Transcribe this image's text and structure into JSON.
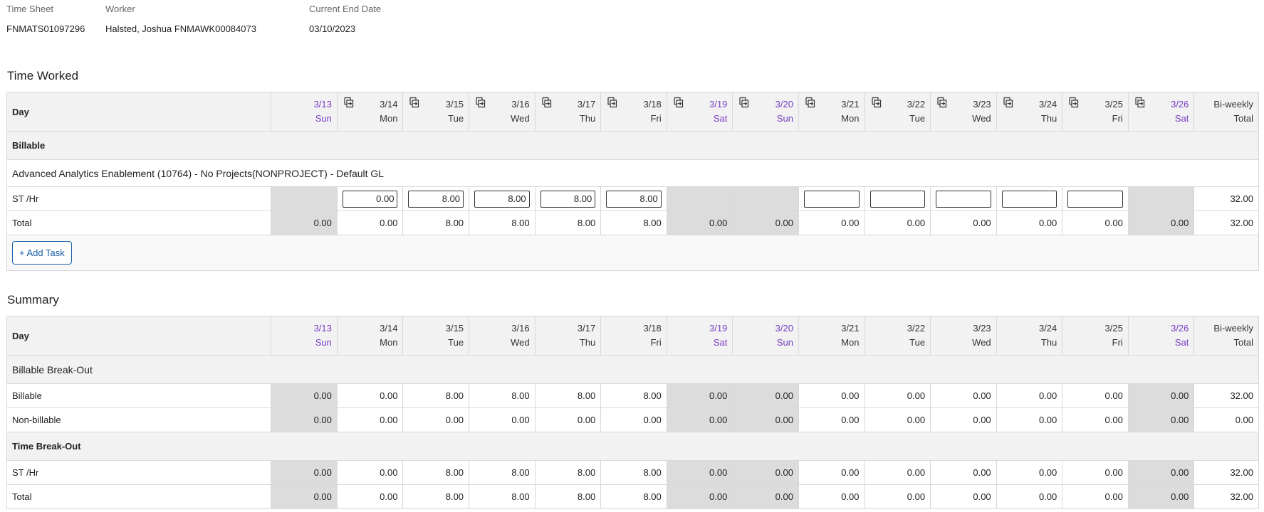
{
  "header": {
    "fields": [
      {
        "label": "Time Sheet",
        "value": "FNMATS01097296"
      },
      {
        "label": "Worker",
        "value": "Halsted, Joshua FNMAWK00084073"
      },
      {
        "label": "Current End Date",
        "value": "03/10/2023"
      }
    ]
  },
  "days": [
    {
      "date": "3/13",
      "dow": "Sun",
      "weekend": true
    },
    {
      "date": "3/14",
      "dow": "Mon",
      "weekend": false
    },
    {
      "date": "3/15",
      "dow": "Tue",
      "weekend": false
    },
    {
      "date": "3/16",
      "dow": "Wed",
      "weekend": false
    },
    {
      "date": "3/17",
      "dow": "Thu",
      "weekend": false
    },
    {
      "date": "3/18",
      "dow": "Fri",
      "weekend": false
    },
    {
      "date": "3/19",
      "dow": "Sat",
      "weekend": true
    },
    {
      "date": "3/20",
      "dow": "Sun",
      "weekend": true
    },
    {
      "date": "3/21",
      "dow": "Mon",
      "weekend": false
    },
    {
      "date": "3/22",
      "dow": "Tue",
      "weekend": false
    },
    {
      "date": "3/23",
      "dow": "Wed",
      "weekend": false
    },
    {
      "date": "3/24",
      "dow": "Thu",
      "weekend": false
    },
    {
      "date": "3/25",
      "dow": "Fri",
      "weekend": false
    },
    {
      "date": "3/26",
      "dow": "Sat",
      "weekend": true
    }
  ],
  "total_header": {
    "line1": "Bi-weekly",
    "line2": "Total"
  },
  "day_label": "Day",
  "colors": {
    "weekend_text": "#7a3cc4",
    "weekend_cell": "#dcdcdc",
    "header_bg": "#f2f2f2",
    "button_blue": "#1a5fa8"
  },
  "time_worked": {
    "title": "Time Worked",
    "group": "Billable",
    "task": "Advanced Analytics Enablement (10764) - No Projects(NONPROJECT) - Default GL",
    "entry_row": {
      "label": "ST /Hr",
      "values": [
        "",
        "0.00",
        "8.00",
        "8.00",
        "8.00",
        "8.00",
        "",
        "",
        "",
        "",
        "",
        "",
        "",
        ""
      ],
      "total": "32.00"
    },
    "total_row": {
      "label": "Total",
      "values": [
        "0.00",
        "0.00",
        "8.00",
        "8.00",
        "8.00",
        "8.00",
        "0.00",
        "0.00",
        "0.00",
        "0.00",
        "0.00",
        "0.00",
        "0.00",
        "0.00"
      ],
      "total": "32.00"
    },
    "add_task_label": "+ Add Task"
  },
  "summary": {
    "title": "Summary",
    "sections": [
      {
        "heading": "Billable Break-Out",
        "bold": false,
        "rows": [
          {
            "label": "Billable",
            "values": [
              "0.00",
              "0.00",
              "8.00",
              "8.00",
              "8.00",
              "8.00",
              "0.00",
              "0.00",
              "0.00",
              "0.00",
              "0.00",
              "0.00",
              "0.00",
              "0.00"
            ],
            "total": "32.00"
          },
          {
            "label": "Non-billable",
            "values": [
              "0.00",
              "0.00",
              "0.00",
              "0.00",
              "0.00",
              "0.00",
              "0.00",
              "0.00",
              "0.00",
              "0.00",
              "0.00",
              "0.00",
              "0.00",
              "0.00"
            ],
            "total": "0.00"
          }
        ]
      },
      {
        "heading": "Time Break-Out",
        "bold": true,
        "rows": [
          {
            "label": "ST /Hr",
            "values": [
              "0.00",
              "0.00",
              "8.00",
              "8.00",
              "8.00",
              "8.00",
              "0.00",
              "0.00",
              "0.00",
              "0.00",
              "0.00",
              "0.00",
              "0.00",
              "0.00"
            ],
            "total": "32.00"
          },
          {
            "label": "Total",
            "values": [
              "0.00",
              "0.00",
              "8.00",
              "8.00",
              "8.00",
              "8.00",
              "0.00",
              "0.00",
              "0.00",
              "0.00",
              "0.00",
              "0.00",
              "0.00",
              "0.00"
            ],
            "total": "32.00"
          }
        ]
      }
    ]
  }
}
